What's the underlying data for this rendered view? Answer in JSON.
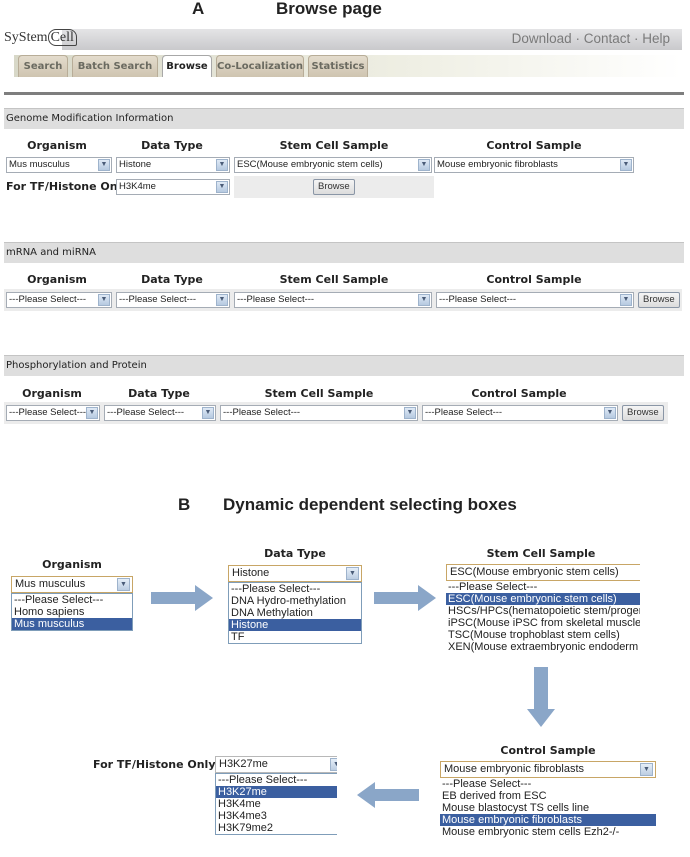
{
  "figure": {
    "panel_a": {
      "letter": "A",
      "title": "Browse page"
    },
    "panel_b": {
      "letter": "B",
      "title": "Dynamic dependent selecting boxes"
    }
  },
  "header": {
    "logo_prefix": "SyStem",
    "logo_cell": "Cell",
    "links": [
      "Download",
      "Contact",
      "Help"
    ],
    "separator": " · "
  },
  "tabs": [
    {
      "label": "Search",
      "active": false
    },
    {
      "label": "Batch Search",
      "active": false
    },
    {
      "label": "Browse",
      "active": true
    },
    {
      "label": "Co-Localization",
      "active": false
    },
    {
      "label": "Statistics",
      "active": false
    }
  ],
  "columns": {
    "organism": "Organism",
    "data_type": "Data Type",
    "stem_cell_sample": "Stem Cell Sample",
    "control_sample": "Control Sample"
  },
  "sections": {
    "genome": {
      "title": "Genome Modification Information",
      "organism": "Mus musculus",
      "data_type": "Histone",
      "stem_cell_sample": "ESC(Mouse embryonic stem cells)",
      "control_sample": "Mouse embryonic fibroblasts",
      "tf_histone_label": "For TF/Histone Only",
      "tf_histone": "H3K4me",
      "browse_label": "Browse"
    },
    "mrna": {
      "title": "mRNA and miRNA",
      "organism": "---Please Select---",
      "data_type": "---Please Select---",
      "stem_cell_sample": "---Please Select---",
      "control_sample": "---Please Select---",
      "browse_label": "Browse"
    },
    "phospho": {
      "title": "Phosphorylation and Protein",
      "organism": "---Please Select---",
      "data_type": "---Please Select---",
      "stem_cell_sample": "---Please Select---",
      "control_sample": "---Please Select---",
      "browse_label": "Browse"
    }
  },
  "dynamic": {
    "organism": {
      "label": "Organism",
      "selected": "Mus musculus",
      "options": [
        "---Please Select---",
        "Homo sapiens",
        "Mus musculus"
      ],
      "selected_index": 2
    },
    "data_type": {
      "label": "Data Type",
      "selected": "Histone",
      "options": [
        "---Please Select---",
        "DNA Hydro-methylation",
        "DNA Methylation",
        "Histone",
        "TF"
      ],
      "selected_index": 3
    },
    "stem_cell_sample": {
      "label": "Stem Cell Sample",
      "selected": "ESC(Mouse embryonic stem cells)",
      "options": [
        "---Please Select---",
        "ESC(Mouse embryonic stem cells)",
        "HSCs/HPCs(hematopoietic stem/progen",
        "iPSC(Mouse iPSC from skeletal muscle",
        "TSC(Mouse trophoblast stem cells)",
        "XEN(Mouse extraembryonic endoderm"
      ],
      "selected_index": 1
    },
    "control_sample": {
      "label": "Control Sample",
      "selected": "Mouse embryonic fibroblasts",
      "options": [
        "---Please Select---",
        "EB derived from ESC",
        "Mouse blastocyst TS cells line",
        "Mouse embryonic fibroblasts",
        "Mouse embryonic stem cells Ezh2-/-"
      ],
      "selected_index": 3
    },
    "tf_histone": {
      "label": "For TF/Histone Only",
      "selected": "H3K27me",
      "options": [
        "---Please Select---",
        "H3K27me",
        "H3K4me",
        "H3K4me3",
        "H3K79me2"
      ],
      "selected_index": 1
    }
  },
  "colors": {
    "selected_option": "#3b5fa0",
    "flow_arrow": "#8aa6c8"
  }
}
